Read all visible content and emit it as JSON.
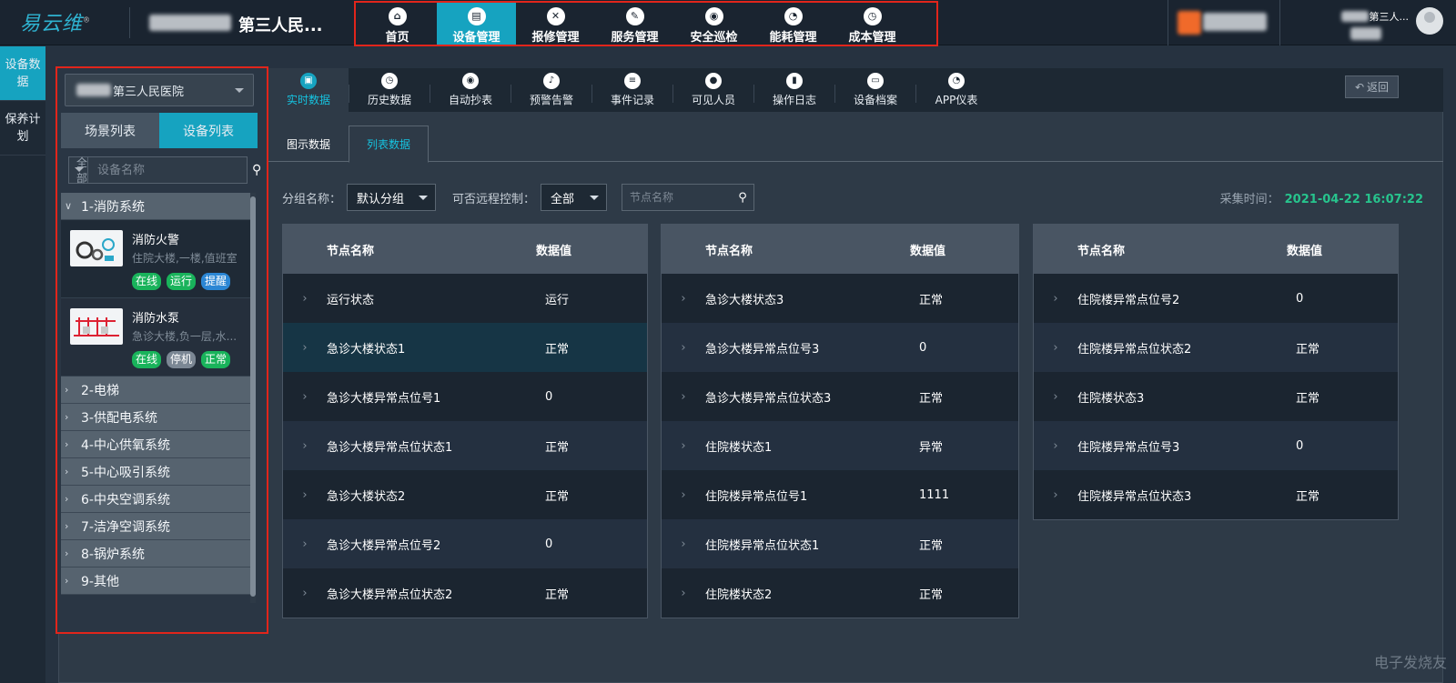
{
  "app": {
    "logo": "易云维",
    "org_name": "第三人民..."
  },
  "main_nav": [
    {
      "label": "首页",
      "icon": "home-icon",
      "glyph": "⌂"
    },
    {
      "label": "设备管理",
      "icon": "device-icon",
      "glyph": "▤"
    },
    {
      "label": "报修管理",
      "icon": "tools-icon",
      "glyph": "✕"
    },
    {
      "label": "服务管理",
      "icon": "edit-icon",
      "glyph": "✎"
    },
    {
      "label": "安全巡检",
      "icon": "location-icon",
      "glyph": "◉"
    },
    {
      "label": "能耗管理",
      "icon": "pie-icon",
      "glyph": "◔"
    },
    {
      "label": "成本管理",
      "icon": "timer-icon",
      "glyph": "◷"
    }
  ],
  "user": {
    "name": "第三人..."
  },
  "left_rail": [
    {
      "label": "设备数据"
    },
    {
      "label": "保养计划"
    }
  ],
  "sidebar": {
    "hospital": "第三人民医院",
    "tabs": [
      "场景列表",
      "设备列表"
    ],
    "filter": "全部",
    "search_placeholder": "设备名称",
    "categories": [
      {
        "label": "1-消防系统",
        "expanded": true
      },
      {
        "label": "2-电梯"
      },
      {
        "label": "3-供配电系统"
      },
      {
        "label": "4-中心供氧系统"
      },
      {
        "label": "5-中心吸引系统"
      },
      {
        "label": "6-中央空调系统"
      },
      {
        "label": "7-洁净空调系统"
      },
      {
        "label": "8-锅炉系统"
      },
      {
        "label": "9-其他"
      }
    ],
    "devices": [
      {
        "name": "消防火警",
        "location": "住院大楼,一楼,值班室",
        "badges": [
          "在线",
          "运行",
          "提醒"
        ]
      },
      {
        "name": "消防水泵",
        "location": "急诊大楼,负一层,水...",
        "badges": [
          "在线",
          "停机",
          "正常"
        ]
      }
    ]
  },
  "sub_nav": [
    {
      "label": "实时数据"
    },
    {
      "label": "历史数据"
    },
    {
      "label": "自动抄表"
    },
    {
      "label": "预警告警"
    },
    {
      "label": "事件记录"
    },
    {
      "label": "可见人员"
    },
    {
      "label": "操作日志"
    },
    {
      "label": "设备档案"
    },
    {
      "label": "APP仪表"
    }
  ],
  "back_label": "返回",
  "view_tabs": [
    "图示数据",
    "列表数据"
  ],
  "filters": {
    "group_label": "分组名称：",
    "group_value": "默认分组",
    "remote_label": "可否远程控制：",
    "remote_value": "全部",
    "node_placeholder": "节点名称",
    "collect_label": "采集时间：",
    "collect_time": "2021-04-22 16:07:22"
  },
  "table_headers": {
    "name": "节点名称",
    "value": "数据值"
  },
  "tables": [
    [
      {
        "name": "运行状态",
        "value": "运行"
      },
      {
        "name": "急诊大楼状态1",
        "value": "正常"
      },
      {
        "name": "急诊大楼异常点位号1",
        "value": "0"
      },
      {
        "name": "急诊大楼异常点位状态1",
        "value": "正常"
      },
      {
        "name": "急诊大楼状态2",
        "value": "正常"
      },
      {
        "name": "急诊大楼异常点位号2",
        "value": "0"
      },
      {
        "name": "急诊大楼异常点位状态2",
        "value": "正常"
      }
    ],
    [
      {
        "name": "急诊大楼状态3",
        "value": "正常"
      },
      {
        "name": "急诊大楼异常点位号3",
        "value": "0"
      },
      {
        "name": "急诊大楼异常点位状态3",
        "value": "正常"
      },
      {
        "name": "住院楼状态1",
        "value": "异常"
      },
      {
        "name": "住院楼异常点位号1",
        "value": "1111"
      },
      {
        "name": "住院楼异常点位状态1",
        "value": "正常"
      },
      {
        "name": "住院楼状态2",
        "value": "正常"
      }
    ],
    [
      {
        "name": "住院楼异常点位号2",
        "value": "0"
      },
      {
        "name": "住院楼异常点位状态2",
        "value": "正常"
      },
      {
        "name": "住院楼状态3",
        "value": "正常"
      },
      {
        "name": "住院楼异常点位号3",
        "value": "0"
      },
      {
        "name": "住院楼异常点位状态3",
        "value": "正常"
      }
    ]
  ],
  "watermark": "电子发烧友",
  "colors": {
    "accent": "#16a3c0",
    "highlight": "#e1251b",
    "online": "#19b35b",
    "time": "#27c48d"
  }
}
